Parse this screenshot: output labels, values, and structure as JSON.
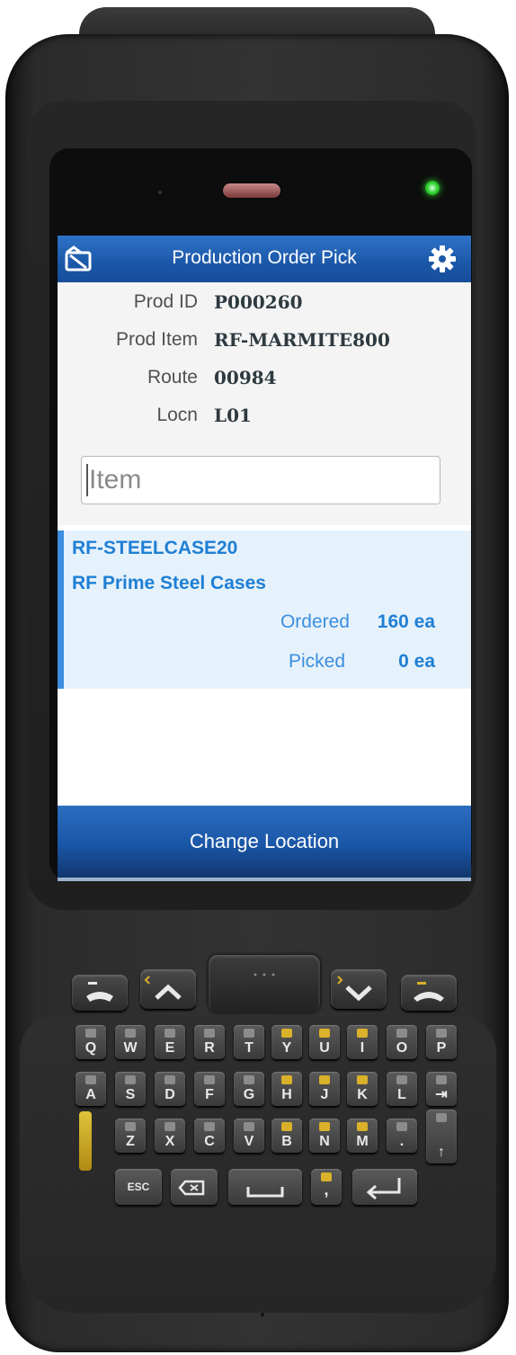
{
  "header": {
    "title": "Production Order Pick"
  },
  "details": [
    {
      "label": "Prod ID",
      "value": "P000260"
    },
    {
      "label": "Prod Item",
      "value": "RF-MARMITE800"
    },
    {
      "label": "Route",
      "value": "00984"
    },
    {
      "label": "Locn",
      "value": "L01"
    }
  ],
  "item_input": {
    "placeholder": "Item",
    "value": ""
  },
  "pick_card": {
    "item_code": "RF-STEELCASE20",
    "description": "RF Prime Steel Cases",
    "ordered_label": "Ordered",
    "ordered_value": "160 ea",
    "picked_label": "Picked",
    "picked_value": "0 ea"
  },
  "actions": {
    "change_location": "Change Location"
  },
  "keypad": {
    "row1": [
      "Q",
      "W",
      "E",
      "R",
      "T",
      "Y",
      "U",
      "I",
      "O",
      "P"
    ],
    "row2": [
      "A",
      "S",
      "D",
      "F",
      "G",
      "H",
      "J",
      "K",
      "L",
      "⇥"
    ],
    "row3": [
      "Z",
      "X",
      "C",
      "V",
      "B",
      "N",
      "M",
      ".",
      "↑"
    ],
    "esc": "ESC",
    "comma": ","
  },
  "colors": {
    "title_bar": "#1b57a8",
    "accent_blue": "#1f7fd4",
    "card_background": "#e6f2fb",
    "led_green": "#2fd12f"
  }
}
